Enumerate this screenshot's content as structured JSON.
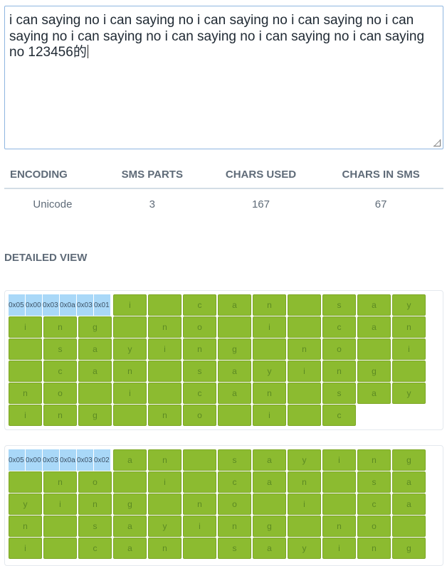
{
  "message": {
    "text": "i can saying no i can saying no i can saying no i can saying no i can saying no i can saying no i can saying no i can saying no i can saying no 123456的"
  },
  "stats": {
    "headers": [
      "ENCODING",
      "SMS PARTS",
      "CHARS USED",
      "CHARS IN SMS"
    ],
    "values": [
      "Unicode",
      "3",
      "167",
      "67"
    ]
  },
  "detail": {
    "title": "DETAILED VIEW",
    "parts": [
      {
        "headers": [
          "0x05",
          "0x00",
          "0x03",
          "0x0a",
          "0x03",
          "0x01"
        ],
        "chars": [
          "i",
          " ",
          "c",
          "a",
          "n",
          " ",
          "s",
          "a",
          "y",
          "i",
          "n",
          "g",
          " ",
          "n",
          "o",
          " ",
          "i",
          " ",
          "c",
          "a",
          "n",
          " ",
          "s",
          "a",
          "y",
          "i",
          "n",
          "g",
          " ",
          "n",
          "o",
          " ",
          "i",
          " ",
          "c",
          "a",
          "n",
          " ",
          "s",
          "a",
          "y",
          "i",
          "n",
          "g",
          " ",
          "n",
          "o",
          " ",
          "i",
          " ",
          "c",
          "a",
          "n",
          " ",
          "s",
          "a",
          "y",
          "i",
          "n",
          "g",
          " ",
          "n",
          "o",
          " ",
          "i",
          " ",
          "c"
        ]
      },
      {
        "headers": [
          "0x05",
          "0x00",
          "0x03",
          "0x0a",
          "0x03",
          "0x02"
        ],
        "chars": [
          "a",
          "n",
          " ",
          "s",
          "a",
          "y",
          "i",
          "n",
          "g",
          " ",
          "n",
          "o",
          " ",
          "i",
          " ",
          "c",
          "a",
          "n",
          " ",
          "s",
          "a",
          "y",
          "i",
          "n",
          "g",
          " ",
          "n",
          "o",
          " ",
          "i",
          " ",
          "c",
          "a",
          "n",
          " ",
          "s",
          "a",
          "y",
          "i",
          "n",
          "g",
          " ",
          "n",
          "o",
          " ",
          "i",
          " ",
          "c",
          "a",
          "n",
          " ",
          "s",
          "a",
          "y",
          "i",
          "n",
          "g"
        ]
      }
    ]
  }
}
